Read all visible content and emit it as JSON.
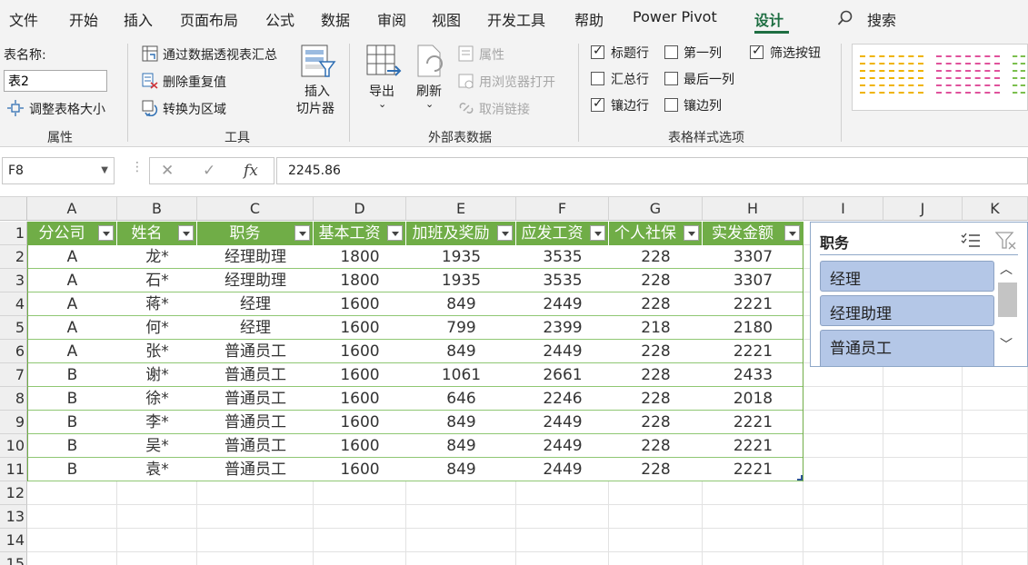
{
  "menu": {
    "tabs": [
      "文件",
      "开始",
      "插入",
      "页面布局",
      "公式",
      "数据",
      "审阅",
      "视图",
      "开发工具",
      "帮助",
      "Power Pivot",
      "设计"
    ],
    "active_tab": "设计",
    "search_label": "搜索"
  },
  "ribbon": {
    "properties": {
      "table_name_label": "表名称:",
      "table_name_value": "表2",
      "resize_label": "调整表格大小",
      "group_label": "属性"
    },
    "tools": {
      "summarize_pivot": "通过数据透视表汇总",
      "remove_duplicates": "删除重复值",
      "convert_to_range": "转换为区域",
      "insert_slicer_line1": "插入",
      "insert_slicer_line2": "切片器",
      "group_label": "工具"
    },
    "external": {
      "export_label": "导出",
      "refresh_label": "刷新",
      "properties_label": "属性",
      "open_browser_label": "用浏览器打开",
      "unlink_label": "取消链接",
      "group_label": "外部表数据"
    },
    "style_options": {
      "header_row": "标题行",
      "total_row": "汇总行",
      "banded_rows": "镶边行",
      "first_column": "第一列",
      "last_column": "最后一列",
      "banded_columns": "镶边列",
      "filter_button": "筛选按钮",
      "group_label": "表格样式选项"
    }
  },
  "formula_bar": {
    "cell_ref": "F8",
    "formula": "2245.86"
  },
  "sheet": {
    "columns": [
      "A",
      "B",
      "C",
      "D",
      "E",
      "F",
      "G",
      "H",
      "I",
      "J",
      "K"
    ],
    "rows": [
      "1",
      "2",
      "3",
      "4",
      "5",
      "6",
      "7",
      "8",
      "9",
      "10",
      "11",
      "12",
      "13",
      "14",
      "15"
    ],
    "table_headers": [
      "分公司",
      "姓名",
      "职务",
      "基本工资",
      "加班及奖励",
      "应发工资",
      "个人社保",
      "实发金额"
    ],
    "table_rows": [
      [
        "A",
        "龙*",
        "经理助理",
        "1800",
        "1935",
        "3535",
        "228",
        "3307"
      ],
      [
        "A",
        "石*",
        "经理助理",
        "1800",
        "1935",
        "3535",
        "228",
        "3307"
      ],
      [
        "A",
        "蒋*",
        "经理",
        "1600",
        "849",
        "2449",
        "228",
        "2221"
      ],
      [
        "A",
        "何*",
        "经理",
        "1600",
        "799",
        "2399",
        "218",
        "2180"
      ],
      [
        "A",
        "张*",
        "普通员工",
        "1600",
        "849",
        "2449",
        "228",
        "2221"
      ],
      [
        "B",
        "谢*",
        "普通员工",
        "1600",
        "1061",
        "2661",
        "228",
        "2433"
      ],
      [
        "B",
        "徐*",
        "普通员工",
        "1600",
        "646",
        "2246",
        "228",
        "2018"
      ],
      [
        "B",
        "李*",
        "普通员工",
        "1600",
        "849",
        "2449",
        "228",
        "2221"
      ],
      [
        "B",
        "吴*",
        "普通员工",
        "1600",
        "849",
        "2449",
        "228",
        "2221"
      ],
      [
        "B",
        "袁*",
        "普通员工",
        "1600",
        "849",
        "2449",
        "228",
        "2221"
      ]
    ]
  },
  "slicer": {
    "title": "职务",
    "items": [
      "经理",
      "经理助理",
      "普通员工"
    ]
  },
  "colors": {
    "accent": "#1e6e42",
    "table_header": "#70ad47",
    "slicer_item": "#b4c7e7"
  }
}
